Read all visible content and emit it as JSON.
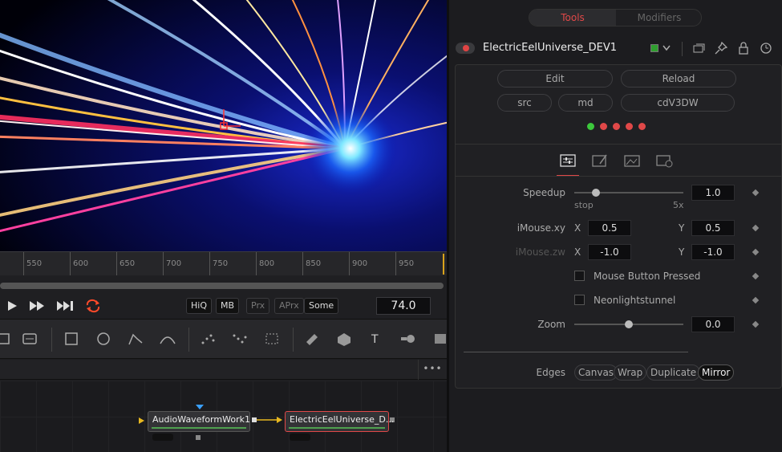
{
  "viewer": {
    "ruler_ticks": [
      "550",
      "600",
      "650",
      "700",
      "750",
      "800",
      "850",
      "900",
      "950"
    ]
  },
  "transport": {
    "quality_buttons": [
      "HiQ",
      "MB",
      "Prx",
      "APrx",
      "Some"
    ],
    "current_frame": "74.0"
  },
  "nodes": {
    "node1": "AudioWaveformWork1",
    "node2": "ElectricEelUniverse_D..."
  },
  "node_header": {
    "more": "•••"
  },
  "inspector": {
    "tabs": {
      "tools": "Tools",
      "modifiers": "Modifiers"
    },
    "tool_name": "ElectricEelUniverse_DEV1",
    "buttons": {
      "edit": "Edit",
      "reload": "Reload",
      "src": "src",
      "md": "md",
      "cdv3dw": "cdV3DW"
    },
    "status_dots": [
      "#3cc83c",
      "#e04848",
      "#e04848",
      "#e04848",
      "#e04848"
    ],
    "params": {
      "speedup": {
        "label": "Speedup",
        "value": "1.0",
        "min_label": "stop",
        "max_label": "5x",
        "level": 0.2
      },
      "imouse_xy": {
        "label": "iMouse.xy",
        "x_label": "X",
        "x": "0.5",
        "y_label": "Y",
        "y": "0.5"
      },
      "imouse_zw": {
        "label": "iMouse.zw",
        "x_label": "X",
        "x": "-1.0",
        "y_label": "Y",
        "y": "-1.0"
      },
      "mouse_button": {
        "label": "Mouse Button Pressed"
      },
      "neonlight": {
        "label": "Neonlightstunnel"
      },
      "zoom": {
        "label": "Zoom",
        "value": "0.0",
        "level": 0.5
      },
      "edges": {
        "label": "Edges",
        "options": [
          "Canvas",
          "Wrap",
          "Duplicate",
          "Mirror"
        ],
        "selected": "Mirror"
      }
    }
  },
  "colors": {
    "accent": "#e04848",
    "green": "#3cc83c"
  }
}
